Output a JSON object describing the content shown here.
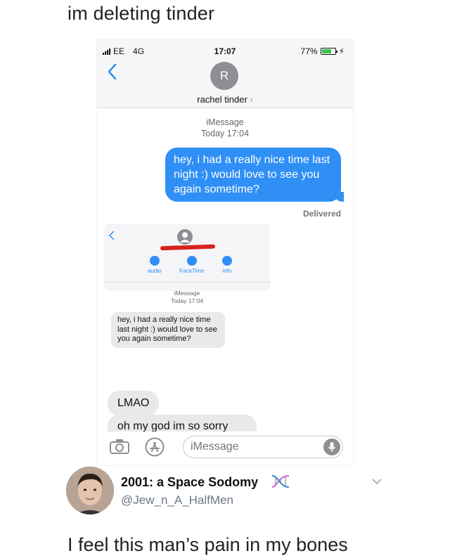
{
  "caption": "im deleting tinder",
  "phone": {
    "status": {
      "carrier": "EE",
      "network": "4G",
      "time": "17:07",
      "battery_pct": "77%",
      "battery_level": 0.77
    },
    "header": {
      "avatar_initial": "R",
      "contact_name": "rachel tinder",
      "contact_chevron": "›"
    },
    "meta": {
      "service": "iMessage",
      "timestamp": "Today 17:04"
    },
    "sent_message": "hey, i had a really nice time last night :) would love to see you again sometime?",
    "delivered": "Delivered",
    "inner_screenshot": {
      "actions": [
        {
          "label": "audio",
          "icon": "phone-icon"
        },
        {
          "label": "FaceTime",
          "icon": "video-icon"
        },
        {
          "label": "info",
          "icon": "info-icon"
        }
      ],
      "meta_service": "iMessage",
      "meta_timestamp": "Today 17:04",
      "received_message": "hey, i had a really nice time last night :) would love to see you again sometime?"
    },
    "reply_1": "LMAO",
    "reply_2": "oh my god im so sorry",
    "input": {
      "placeholder": "iMessage"
    }
  },
  "tweet": {
    "display_name": "2001: a Space Sodomy",
    "handle": "@Jew_n_A_HalfMen",
    "text": "I feel this man’s pain in my bones"
  },
  "colors": {
    "imessage_blue": "#2f8ff5",
    "received_gray": "#e9e9eb",
    "redaction_red": "#d7231b",
    "handle_gray": "#6b7785"
  }
}
